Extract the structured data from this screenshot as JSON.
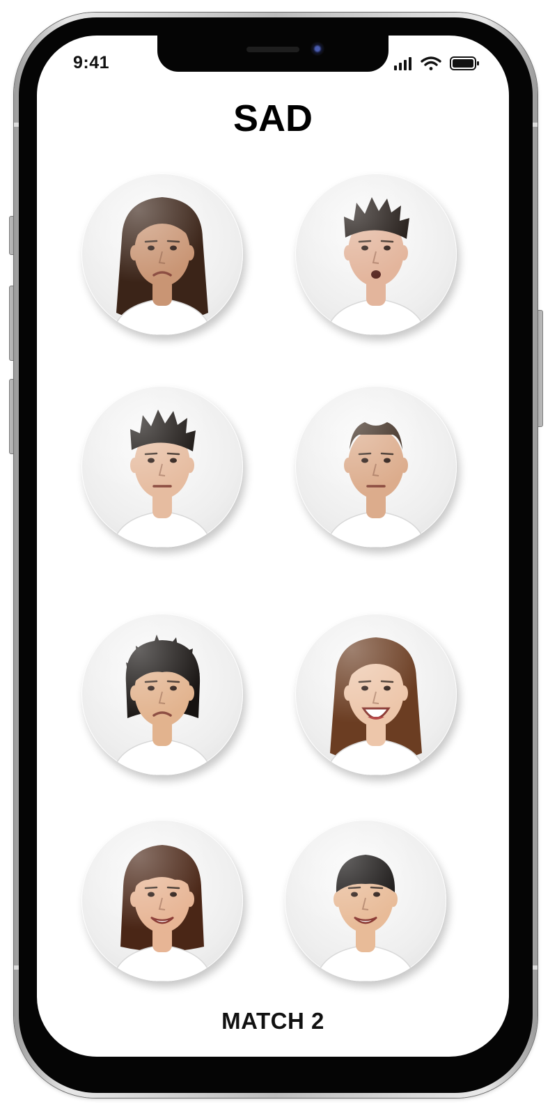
{
  "status_bar": {
    "time": "9:41",
    "icons": [
      "signal-icon",
      "wifi-icon",
      "battery-icon"
    ]
  },
  "title": "SAD",
  "faces": [
    {
      "name": "face-1",
      "skin": "#c99574",
      "hair": "#3b2418",
      "shirt": "#ffffff",
      "hair_style": "long",
      "mouth": "frown"
    },
    {
      "name": "face-2",
      "skin": "#e3b59c",
      "hair": "#1c1410",
      "shirt": "#ffffff",
      "hair_style": "spiky",
      "mouth": "open"
    },
    {
      "name": "face-3",
      "skin": "#e6bca0",
      "hair": "#15100d",
      "shirt": "#ffffff",
      "hair_style": "spiky",
      "mouth": "flat"
    },
    {
      "name": "face-4",
      "skin": "#dcac8c",
      "hair": "#3b2a1e",
      "shirt": "#ffffff",
      "hair_style": "bald",
      "mouth": "flat"
    },
    {
      "name": "face-5",
      "skin": "#e2b38e",
      "hair": "#161210",
      "shirt": "#ffffff",
      "hair_style": "messy",
      "mouth": "frown"
    },
    {
      "name": "face-6",
      "skin": "#edc6aa",
      "hair": "#6b3d22",
      "shirt": "#ffffff",
      "hair_style": "long",
      "mouth": "big-smile"
    },
    {
      "name": "face-7",
      "skin": "#e7b595",
      "hair": "#4a2616",
      "shirt": "#ffffff",
      "hair_style": "bob",
      "mouth": "smile"
    },
    {
      "name": "face-8",
      "skin": "#e8bb98",
      "hair": "#151211",
      "shirt": "#ffffff",
      "hair_style": "bowl",
      "mouth": "smile"
    }
  ],
  "footer": {
    "label": "MATCH 2"
  }
}
